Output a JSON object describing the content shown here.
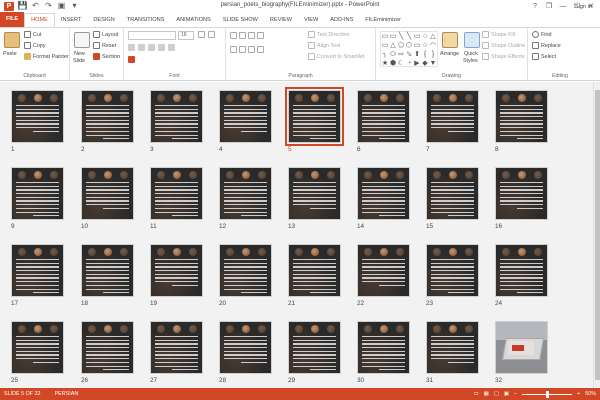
{
  "window": {
    "title": "persian_poets_biography(FILEminimizer).pptx - PowerPoint",
    "logo": "P",
    "controls": {
      "help": "?",
      "restore": "❐",
      "minimize": "—",
      "maximize": "☐",
      "close": "✕"
    }
  },
  "qat": {
    "save_icon": "💾",
    "undo_icon": "↶",
    "redo_icon": "↷",
    "start_icon": "▣",
    "customize_icon": "▾"
  },
  "tabs": [
    {
      "label": "FILE",
      "kind": "file"
    },
    {
      "label": "HOME",
      "kind": "active"
    },
    {
      "label": "INSERT",
      "kind": ""
    },
    {
      "label": "DESIGN",
      "kind": ""
    },
    {
      "label": "TRANSITIONS",
      "kind": ""
    },
    {
      "label": "ANIMATIONS",
      "kind": ""
    },
    {
      "label": "SLIDE SHOW",
      "kind": ""
    },
    {
      "label": "REVIEW",
      "kind": ""
    },
    {
      "label": "VIEW",
      "kind": ""
    },
    {
      "label": "ADD-INS",
      "kind": ""
    },
    {
      "label": "FILEminimizer",
      "kind": ""
    }
  ],
  "signin": "Sign in",
  "ribbon": {
    "clipboard": {
      "label": "Clipboard",
      "paste": "Paste",
      "cut": "Cut",
      "copy": "Copy",
      "format_painter": "Format Painter"
    },
    "slides": {
      "label": "Slides",
      "new_slide": "New",
      "new_slide_2": "Slide",
      "layout": "Layout",
      "reset": "Reset",
      "section": "Section"
    },
    "font": {
      "label": "Font",
      "font_name": "",
      "font_size": "18"
    },
    "paragraph": {
      "label": "Paragraph",
      "text_direction": "Text Direction",
      "align_text": "Align Text",
      "convert_smartart": "Convert to SmartArt"
    },
    "drawing": {
      "label": "Drawing",
      "arrange": "Arrange",
      "quick_styles": "Quick",
      "quick_styles_2": "Styles",
      "shape_fill": "Shape Fill",
      "shape_outline": "Shape Outline",
      "shape_effects": "Shape Effects"
    },
    "editing": {
      "label": "Editing",
      "find": "Find",
      "replace": "Replace",
      "select": "Select"
    },
    "shape_glyphs": [
      "▭",
      "▭",
      "╲",
      "╲",
      "▭",
      "○",
      "△",
      "▭",
      "△",
      "⬠",
      "⬡",
      "▭",
      "☆",
      "◠",
      "╮",
      "⬭",
      "⇨",
      "⬂",
      "⬆",
      "{",
      "}",
      "★",
      "⬢",
      "☾",
      "◔",
      "▶",
      "◆",
      "▼"
    ]
  },
  "slides": [
    {
      "num": "1"
    },
    {
      "num": "2"
    },
    {
      "num": "3"
    },
    {
      "num": "4"
    },
    {
      "num": "5",
      "selected": true
    },
    {
      "num": "6"
    },
    {
      "num": "7"
    },
    {
      "num": "8"
    },
    {
      "num": "9"
    },
    {
      "num": "10"
    },
    {
      "num": "11"
    },
    {
      "num": "12"
    },
    {
      "num": "13"
    },
    {
      "num": "14"
    },
    {
      "num": "15"
    },
    {
      "num": "16"
    },
    {
      "num": "17"
    },
    {
      "num": "18"
    },
    {
      "num": "19"
    },
    {
      "num": "20"
    },
    {
      "num": "21"
    },
    {
      "num": "22"
    },
    {
      "num": "23"
    },
    {
      "num": "24"
    },
    {
      "num": "25"
    },
    {
      "num": "26"
    },
    {
      "num": "27"
    },
    {
      "num": "28"
    },
    {
      "num": "29"
    },
    {
      "num": "30"
    },
    {
      "num": "31"
    },
    {
      "num": "32",
      "last": true
    }
  ],
  "status": {
    "slide": "SLIDE 5 OF 32",
    "language": "PERSIAN",
    "zoom": "50%",
    "zoom_minus": "−",
    "zoom_plus": "+"
  },
  "colors": {
    "accent": "#d24726"
  }
}
